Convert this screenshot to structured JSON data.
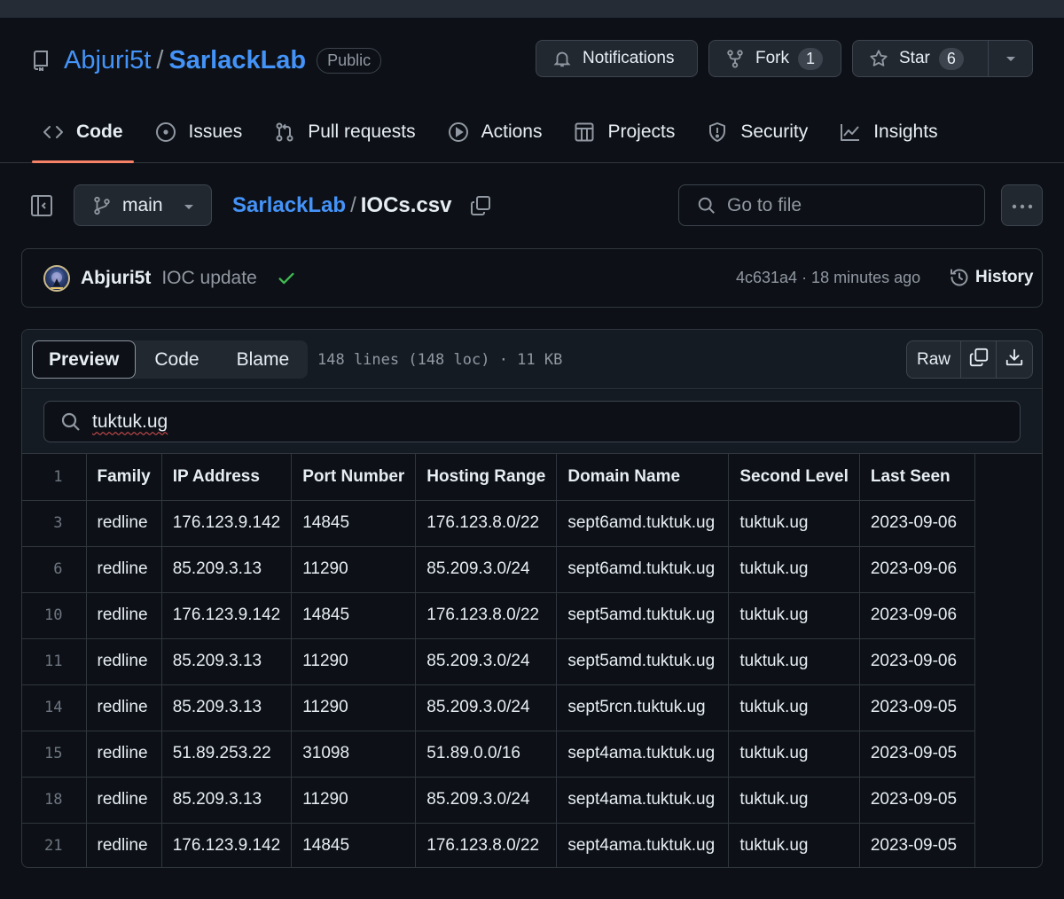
{
  "repo": {
    "owner": "Abjuri5t",
    "slash": "/",
    "name": "SarlackLab",
    "visibility": "Public"
  },
  "header_buttons": {
    "notifications": "Notifications",
    "fork_label": "Fork",
    "fork_count": "1",
    "star_label": "Star",
    "star_count": "6"
  },
  "tabs": [
    {
      "label": "Code",
      "icon": "code-icon",
      "active": true
    },
    {
      "label": "Issues",
      "icon": "issue-circle-icon"
    },
    {
      "label": "Pull requests",
      "icon": "pull-request-icon"
    },
    {
      "label": "Actions",
      "icon": "play-circle-icon"
    },
    {
      "label": "Projects",
      "icon": "table-icon"
    },
    {
      "label": "Security",
      "icon": "shield-icon"
    },
    {
      "label": "Insights",
      "icon": "graph-icon"
    }
  ],
  "file_nav": {
    "branch": "main",
    "breadcrumb_repo": "SarlackLab",
    "breadcrumb_sep": "/",
    "file_name": "IOCs.csv",
    "goto_placeholder": "Go to file"
  },
  "commit": {
    "author": "Abjuri5t",
    "message": "IOC update",
    "meta": "4c631a4 · 18 minutes ago",
    "history": "History"
  },
  "viewer": {
    "tabs": [
      "Preview",
      "Code",
      "Blame"
    ],
    "active_tab": "Preview",
    "file_info": "148 lines (148 loc) · 11 KB",
    "raw": "Raw",
    "search_value": "tuktuk.ug"
  },
  "table": {
    "header_line": "1",
    "columns": [
      "Family",
      "IP Address",
      "Port Number",
      "Hosting Range",
      "Domain Name",
      "Second Level",
      "Last Seen"
    ],
    "rows": [
      {
        "line": "3",
        "cells": [
          "redline",
          "176.123.9.142",
          "14845",
          "176.123.8.0/22",
          "sept6amd.tuktuk.ug",
          "tuktuk.ug",
          "2023-09-06"
        ]
      },
      {
        "line": "6",
        "cells": [
          "redline",
          "85.209.3.13",
          "11290",
          "85.209.3.0/24",
          "sept6amd.tuktuk.ug",
          "tuktuk.ug",
          "2023-09-06"
        ]
      },
      {
        "line": "10",
        "cells": [
          "redline",
          "176.123.9.142",
          "14845",
          "176.123.8.0/22",
          "sept5amd.tuktuk.ug",
          "tuktuk.ug",
          "2023-09-06"
        ]
      },
      {
        "line": "11",
        "cells": [
          "redline",
          "85.209.3.13",
          "11290",
          "85.209.3.0/24",
          "sept5amd.tuktuk.ug",
          "tuktuk.ug",
          "2023-09-06"
        ]
      },
      {
        "line": "14",
        "cells": [
          "redline",
          "85.209.3.13",
          "11290",
          "85.209.3.0/24",
          "sept5rcn.tuktuk.ug",
          "tuktuk.ug",
          "2023-09-05"
        ]
      },
      {
        "line": "15",
        "cells": [
          "redline",
          "51.89.253.22",
          "31098",
          "51.89.0.0/16",
          "sept4ama.tuktuk.ug",
          "tuktuk.ug",
          "2023-09-05"
        ]
      },
      {
        "line": "18",
        "cells": [
          "redline",
          "85.209.3.13",
          "11290",
          "85.209.3.0/24",
          "sept4ama.tuktuk.ug",
          "tuktuk.ug",
          "2023-09-05"
        ]
      },
      {
        "line": "21",
        "cells": [
          "redline",
          "176.123.9.142",
          "14845",
          "176.123.8.0/22",
          "sept4ama.tuktuk.ug",
          "tuktuk.ug",
          "2023-09-05"
        ]
      }
    ]
  },
  "colors": {
    "background": "#0d1117",
    "link": "#4493f8",
    "active_tab_underline": "#f78166",
    "success": "#3fb950"
  }
}
